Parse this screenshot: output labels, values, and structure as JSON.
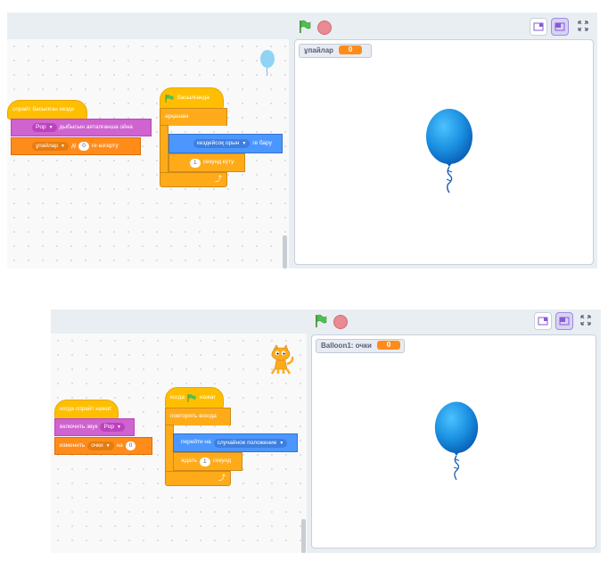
{
  "top": {
    "hat_when_sprite_clicked": "спрайт басылған кезде",
    "sound_block_prefix": "",
    "sound_dropdown": "Pop",
    "sound_block_suffix": "дыбысын аяталғанша ойна",
    "var_dropdown": "ұпайлар",
    "var_block_mid": "ді",
    "var_value": "0",
    "var_block_suffix": "ге өзгерту",
    "hat_when_flag": "басылғанда",
    "forever_label": "әрқашан",
    "goto_dropdown": "кездейсоқ орын",
    "goto_suffix": "ге бару",
    "wait_value": "1",
    "wait_suffix": "секунд күту",
    "monitor_label": "ұпайлар",
    "monitor_value": "0"
  },
  "bottom": {
    "hat_when_sprite_clicked": "когда спрайт нажат",
    "sound_block_prefix": "включить звук",
    "sound_dropdown": "Pop",
    "var_block_prefix": "изменить",
    "var_dropdown": "очки",
    "var_block_mid": "на",
    "var_value": "0",
    "hat_when_flag_prefix": "когда",
    "hat_when_flag_suffix": "нажат",
    "forever_label": "повторять всегда",
    "goto_prefix": "перейти на",
    "goto_dropdown": "случайное положение",
    "wait_prefix": "ждать",
    "wait_value": "1",
    "wait_suffix": "секунд",
    "monitor_label": "Balloon1: очки",
    "monitor_value": "0"
  },
  "colors": {
    "events": "#ffbf00",
    "control": "#ffab19",
    "sound": "#cf63cf",
    "variables": "#ff8c1a",
    "motion": "#4c97ff",
    "balloon": "#1a8fe0"
  },
  "icons": [
    "green-flag-icon",
    "stop-icon",
    "small-stage-icon",
    "large-stage-icon",
    "fullscreen-icon",
    "balloon-sprite",
    "cat-sprite",
    "redo-arrow-icon"
  ]
}
